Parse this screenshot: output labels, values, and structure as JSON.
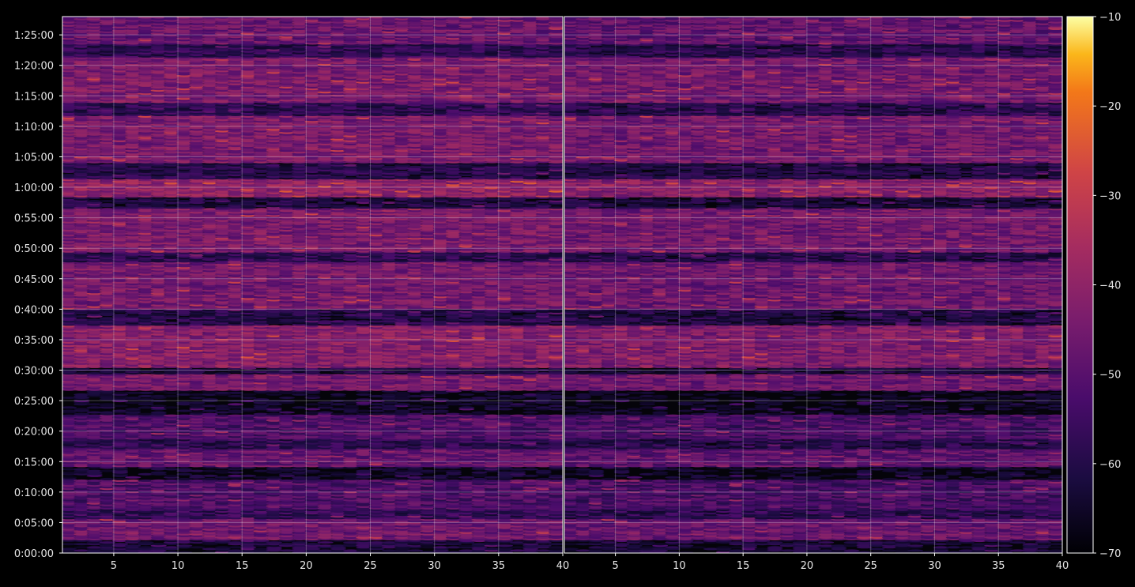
{
  "chart_data": {
    "type": "heatmap",
    "title": "",
    "xlabel": "",
    "ylabel": "",
    "colormap": "inferno",
    "background": "#000000",
    "grid": true,
    "panels": [
      {
        "name": "",
        "xlim": [
          1,
          40
        ],
        "x_ticks": [
          "5",
          "10",
          "15",
          "20",
          "25",
          "30",
          "35",
          "40"
        ],
        "x_tick_values": [
          5,
          10,
          15,
          20,
          25,
          30,
          35,
          40
        ]
      },
      {
        "name": "",
        "xlim": [
          1,
          40
        ],
        "x_ticks": [
          "5",
          "10",
          "15",
          "20",
          "25",
          "30",
          "35",
          "40"
        ],
        "x_tick_values": [
          5,
          10,
          15,
          20,
          25,
          30,
          35,
          40
        ]
      }
    ],
    "y_ticks": [
      "0:00:00",
      "0:05:00",
      "0:10:00",
      "0:15:00",
      "0:20:00",
      "0:25:00",
      "0:30:00",
      "0:35:00",
      "0:40:00",
      "0:45:00",
      "0:50:00",
      "0:55:00",
      "1:00:00",
      "1:05:00",
      "1:10:00",
      "1:15:00",
      "1:20:00",
      "1:25:00"
    ],
    "y_tick_values_s": [
      0,
      300,
      600,
      900,
      1200,
      1500,
      1800,
      2100,
      2400,
      2700,
      3000,
      3300,
      3600,
      3900,
      4200,
      4500,
      4800,
      5100
    ],
    "ylim_s": [
      0,
      5280
    ],
    "colorbar": {
      "ticks": [
        "−10",
        "−20",
        "−30",
        "−40",
        "−50",
        "−60",
        "−70"
      ],
      "tick_values": [
        -10,
        -20,
        -30,
        -40,
        -50,
        -60,
        -70
      ],
      "range": [
        -70,
        -10
      ]
    },
    "band_levels": [
      {
        "t_start_s": 0,
        "t_end_s": 120,
        "level": -62
      },
      {
        "t_start_s": 120,
        "t_end_s": 330,
        "level": -46
      },
      {
        "t_start_s": 330,
        "t_end_s": 420,
        "level": -57
      },
      {
        "t_start_s": 420,
        "t_end_s": 720,
        "level": -52
      },
      {
        "t_start_s": 720,
        "t_end_s": 840,
        "level": -66
      },
      {
        "t_start_s": 840,
        "t_end_s": 1020,
        "level": -48
      },
      {
        "t_start_s": 1020,
        "t_end_s": 1110,
        "level": -58
      },
      {
        "t_start_s": 1110,
        "t_end_s": 1350,
        "level": -52
      },
      {
        "t_start_s": 1350,
        "t_end_s": 1600,
        "level": -67
      },
      {
        "t_start_s": 1600,
        "t_end_s": 1760,
        "level": -45
      },
      {
        "t_start_s": 1760,
        "t_end_s": 1820,
        "level": -62
      },
      {
        "t_start_s": 1820,
        "t_end_s": 2230,
        "level": -42
      },
      {
        "t_start_s": 2230,
        "t_end_s": 2400,
        "level": -60
      },
      {
        "t_start_s": 2400,
        "t_end_s": 2850,
        "level": -45
      },
      {
        "t_start_s": 2850,
        "t_end_s": 2960,
        "level": -58
      },
      {
        "t_start_s": 2960,
        "t_end_s": 3380,
        "level": -44
      },
      {
        "t_start_s": 3380,
        "t_end_s": 3500,
        "level": -62
      },
      {
        "t_start_s": 3500,
        "t_end_s": 3680,
        "level": -40
      },
      {
        "t_start_s": 3680,
        "t_end_s": 3840,
        "level": -60
      },
      {
        "t_start_s": 3840,
        "t_end_s": 4300,
        "level": -44
      },
      {
        "t_start_s": 4300,
        "t_end_s": 4420,
        "level": -58
      },
      {
        "t_start_s": 4420,
        "t_end_s": 4870,
        "level": -44
      },
      {
        "t_start_s": 4870,
        "t_end_s": 5000,
        "level": -58
      },
      {
        "t_start_s": 5000,
        "t_end_s": 5280,
        "level": -47
      }
    ]
  }
}
